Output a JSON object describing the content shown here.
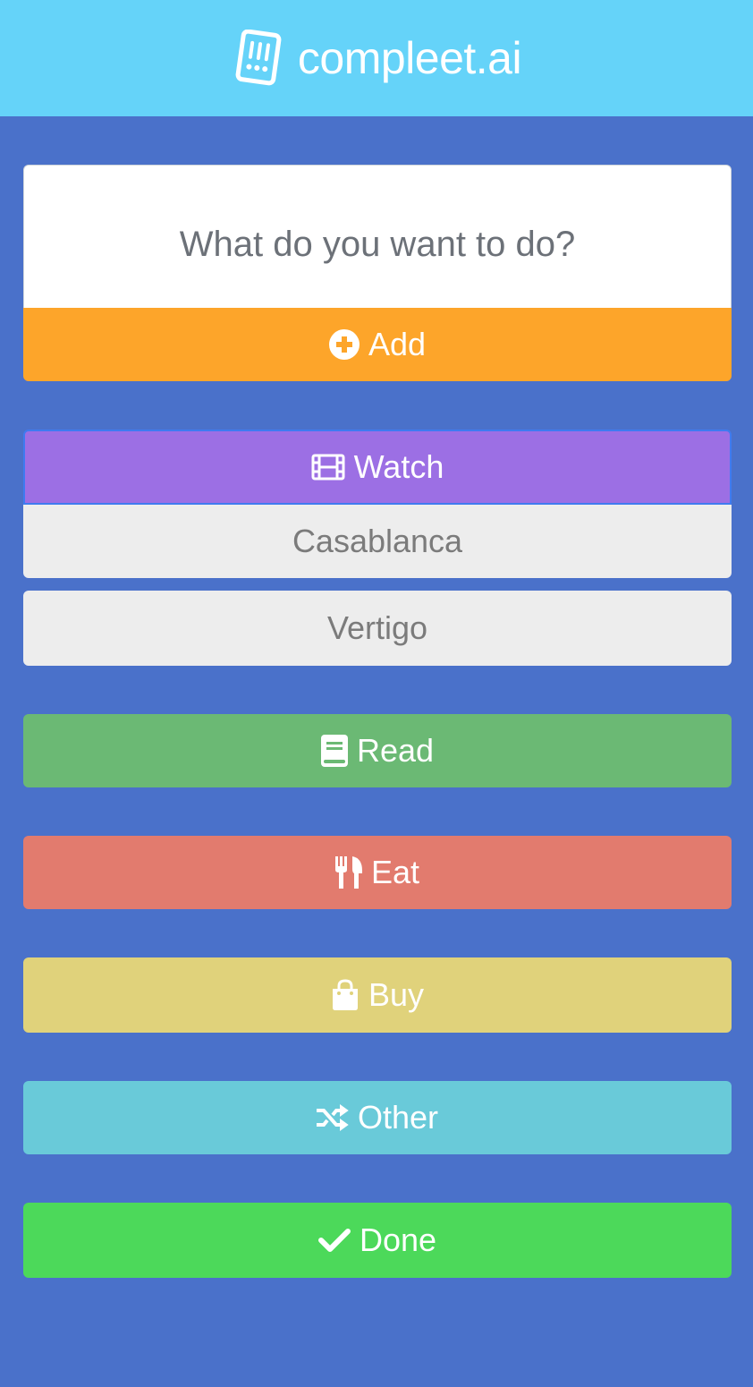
{
  "header": {
    "brand": "compleet.ai",
    "logo_icon": "checklist-logo-icon",
    "background": "#65d3f9"
  },
  "composer": {
    "placeholder": "What do you want to do?",
    "add_label": "Add",
    "add_icon": "plus-circle-icon",
    "add_color": "#fda52a"
  },
  "categories": {
    "watch": {
      "label": "Watch",
      "icon": "film-icon",
      "color": "#9c6fe4",
      "items": [
        "Casablanca",
        "Vertigo"
      ]
    },
    "read": {
      "label": "Read",
      "icon": "book-icon",
      "color": "#6bb974"
    },
    "eat": {
      "label": "Eat",
      "icon": "utensils-icon",
      "color": "#e27b6e"
    },
    "buy": {
      "label": "Buy",
      "icon": "shopping-bag-icon",
      "color": "#e0d27b"
    },
    "other": {
      "label": "Other",
      "icon": "shuffle-icon",
      "color": "#69cad9"
    },
    "done": {
      "label": "Done",
      "icon": "check-icon",
      "color": "#4cd95a"
    }
  },
  "page_background": "#4a71ca"
}
